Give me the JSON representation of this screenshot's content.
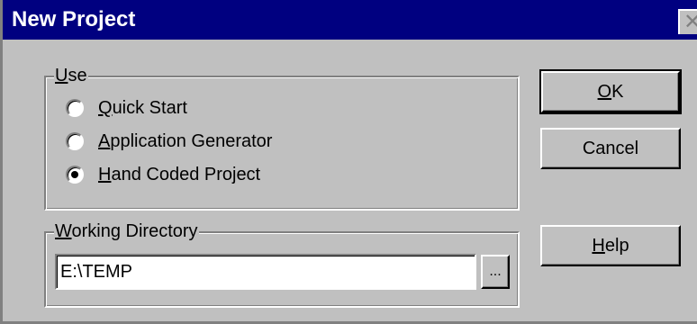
{
  "window": {
    "title": "New Project",
    "close_glyph": "✕"
  },
  "use_group": {
    "legend": "Use",
    "options": [
      {
        "label": "Quick Start",
        "selected": false
      },
      {
        "label": "Application Generator",
        "selected": false
      },
      {
        "label": "Hand Coded Project",
        "selected": true
      }
    ]
  },
  "working_directory": {
    "legend": "Working Directory",
    "value": "E:\\TEMP",
    "browse_label": "..."
  },
  "buttons": {
    "ok_label": "OK",
    "cancel_label": "Cancel",
    "help_label": "Help"
  },
  "colors": {
    "titlebar": "#000080",
    "face": "#c0c0c0"
  }
}
